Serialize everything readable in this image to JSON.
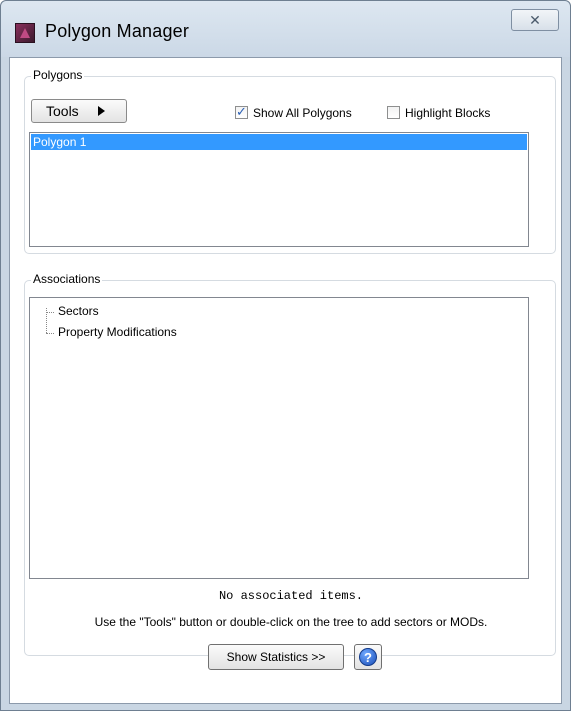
{
  "window": {
    "title": "Polygon Manager",
    "close_glyph": "✕"
  },
  "polygons_group": {
    "label": "Polygons",
    "tools_label": "Tools",
    "show_all": {
      "label": "Show All Polygons",
      "checked": true
    },
    "highlight_blocks": {
      "label": "Highlight Blocks",
      "checked": false
    },
    "items": [
      "Polygon 1"
    ],
    "selected_index": 0
  },
  "associations_group": {
    "label": "Associations",
    "tree": [
      "Sectors",
      "Property Modifications"
    ],
    "status": "No associated items.",
    "hint": "Use the \"Tools\" button or double-click on the tree to add sectors or MODs."
  },
  "footer": {
    "stats_label": "Show Statistics >>",
    "help_glyph": "?"
  }
}
